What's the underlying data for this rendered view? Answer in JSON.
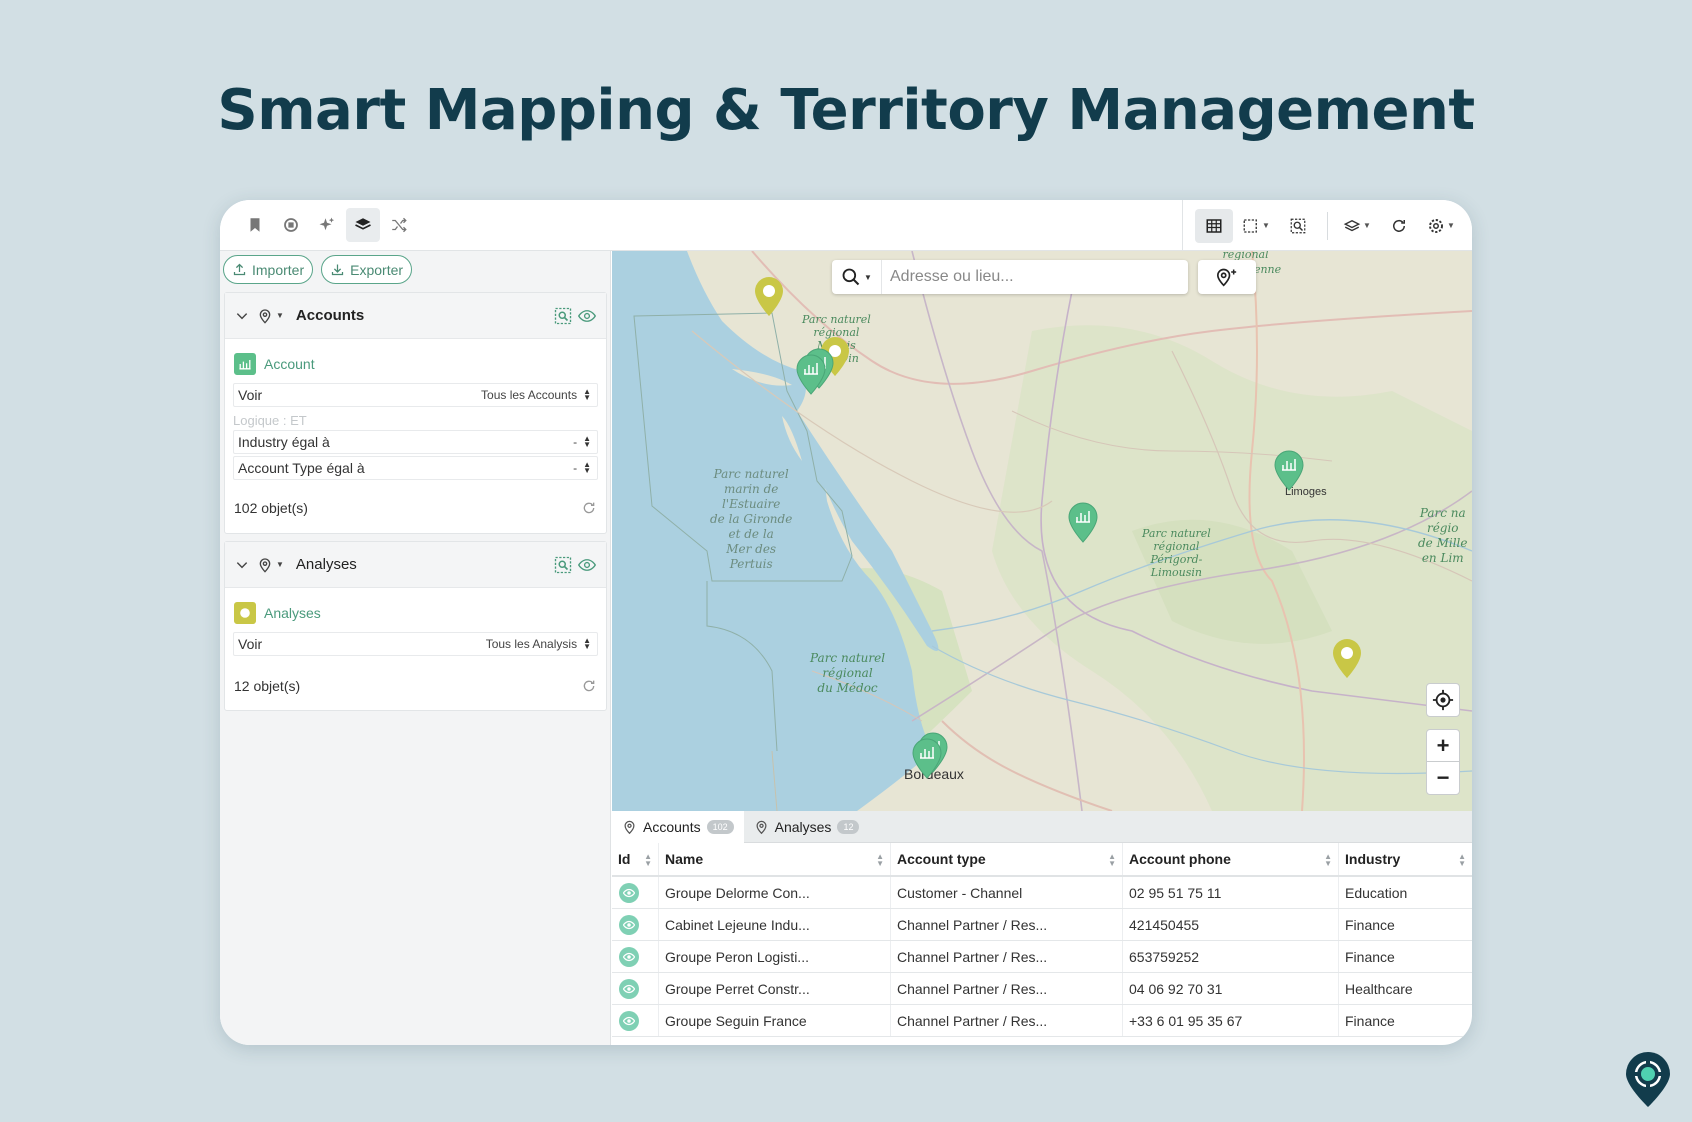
{
  "headline": "Smart Mapping & Territory Management",
  "colors": {
    "brand": "#123c4c",
    "accent": "#4a9a7c",
    "marker_green": "#5cbf8a",
    "marker_yellow": "#c9c746",
    "background": "#d2dfe4"
  },
  "toolbar": {
    "left_icons": [
      "bookmark-icon",
      "chip-icon",
      "sparkle-icon",
      "layers-icon",
      "shuffle-icon"
    ],
    "right_icons": [
      "table-icon",
      "select-area-icon",
      "zoom-selection-icon",
      "layers-dropdown-icon",
      "refresh-icon",
      "settings-icon"
    ]
  },
  "sidebar": {
    "import_label": "Importer",
    "export_label": "Exporter",
    "layers": [
      {
        "title": "Accounts",
        "object_name": "Account",
        "voir_label": "Voir",
        "voir_value": "Tous les Accounts",
        "logic_label": "Logique : ET",
        "filters": [
          {
            "label": "Industry égal à",
            "value": "-"
          },
          {
            "label": "Account Type égal à",
            "value": "-"
          }
        ],
        "count": "102 objet(s)"
      },
      {
        "title": "Analyses",
        "object_name": "Analyses",
        "voir_label": "Voir",
        "voir_value": "Tous les Analysis",
        "count": "12 objet(s)"
      }
    ]
  },
  "map": {
    "search_placeholder": "Adresse ou lieu...",
    "zoom_in": "+",
    "zoom_out": "−",
    "labels": {
      "brenne": "régional\nde la Brenne",
      "marais": "Parc naturel\nrégional\nMarais\npoitevin",
      "gironde": "Parc naturel\nmarin de\nl'Estuaire\nde la Gironde\net de la\nMer des\nPertuis",
      "perigord": "Parc naturel\nrégional\nPérigord-\nLimousin",
      "millevaches": "Parc na\nrégio\nde Mille\nen Lim",
      "medoc": "Parc naturel\nrégional\ndu Médoc"
    },
    "cities": {
      "limoges": "Limoges",
      "bordeaux": "Bordeaux"
    }
  },
  "tabs": [
    {
      "label": "Accounts",
      "count": "102"
    },
    {
      "label": "Analyses",
      "count": "12"
    }
  ],
  "table": {
    "headers": [
      "Id",
      "Name",
      "Account type",
      "Account phone",
      "Industry"
    ],
    "rows": [
      {
        "name": "Groupe Delorme Con...",
        "type": "Customer - Channel",
        "phone": "02 95 51 75 11",
        "industry": "Education"
      },
      {
        "name": "Cabinet Lejeune Indu...",
        "type": "Channel Partner / Res...",
        "phone": "421450455",
        "industry": "Finance"
      },
      {
        "name": "Groupe Peron Logisti...",
        "type": "Channel Partner / Res...",
        "phone": "653759252",
        "industry": "Finance"
      },
      {
        "name": "Groupe Perret Constr...",
        "type": "Channel Partner / Res...",
        "phone": "04 06 92 70 31",
        "industry": "Healthcare"
      },
      {
        "name": "Groupe Seguin France",
        "type": "Channel Partner / Res...",
        "phone": "+33 6 01 95 35 67",
        "industry": "Finance"
      }
    ]
  }
}
